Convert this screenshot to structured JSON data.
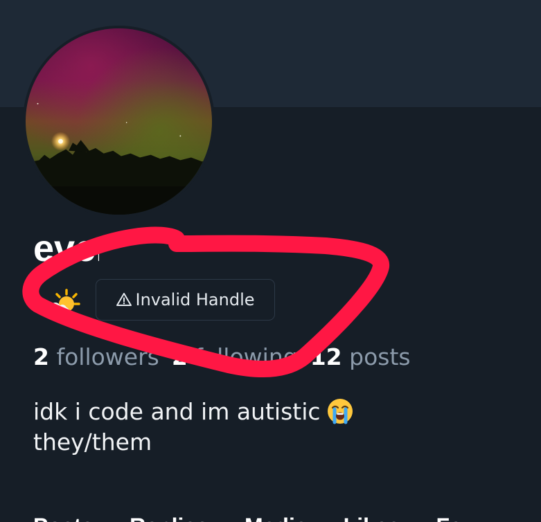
{
  "profile": {
    "display_name": "everly",
    "handle_badge": "Invalid Handle",
    "stats": [
      {
        "num": "2",
        "label": "followers"
      },
      {
        "num": "2",
        "label": "following"
      },
      {
        "num": "12",
        "label": "posts"
      }
    ],
    "bio": {
      "line1": "idk i code and im autistic",
      "line2": "they/them"
    }
  },
  "tabs": [
    {
      "label": "Posts"
    },
    {
      "label": "Replies"
    },
    {
      "label": "Media"
    },
    {
      "label": "Likes"
    },
    {
      "label": "Fe"
    }
  ],
  "icons": {
    "avatar": "aurora-photo",
    "status": "sun-behind-cloud-emoji",
    "badge": "warning-triangle-icon",
    "bio_emoji": "loudly-crying-face-emoji"
  },
  "colors": {
    "background": "#161e27",
    "banner": "#1e2936",
    "text": "#ffffff",
    "muted": "#8c9bab",
    "annotation": "#ff1744"
  }
}
